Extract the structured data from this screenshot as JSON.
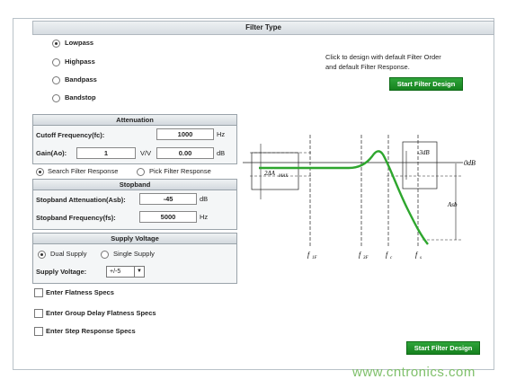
{
  "filter_type": {
    "title": "Filter Type",
    "options": [
      "Lowpass",
      "Highpass",
      "Bandpass",
      "Bandstop"
    ],
    "selected": "Lowpass",
    "hint_line1": "Click to design with default Filter Order",
    "hint_line2": "and default Filter Response.",
    "button": "Start Filter Design"
  },
  "attenuation": {
    "title": "Attenuation",
    "cutoff_label": "Cutoff Frequency(fc):",
    "cutoff_value": "1000",
    "cutoff_unit": "Hz",
    "gain_label": "Gain(Ao):",
    "gain_value": "1",
    "gain_unit": "V/V",
    "gain_db_value": "0.00",
    "gain_db_unit": "dB"
  },
  "search_mode": {
    "search_label": "Search Filter Response",
    "pick_label": "Pick Filter Response",
    "selected": "search"
  },
  "stopband": {
    "title": "Stopband",
    "attenuation_label": "Stopband Attenuation(Asb):",
    "attenuation_value": "-45",
    "attenuation_unit": "dB",
    "frequency_label": "Stopband Frequency(fs):",
    "frequency_value": "5000",
    "frequency_unit": "Hz"
  },
  "supply": {
    "title": "Supply Voltage",
    "dual_label": "Dual Supply",
    "single_label": "Single Supply",
    "selected": "dual",
    "voltage_label": "Supply Voltage:",
    "voltage_value": "+/-5"
  },
  "checkboxes": [
    "Enter Flatness Specs",
    "Enter Group Delay Flatness Specs",
    "Enter Step Response Specs"
  ],
  "bottom_button": "Start Filter Design",
  "diagram": {
    "label_0db": "0dB",
    "label_3db": "-3dB",
    "label_delta": "2ΔA",
    "label_delta_sub": "MAX",
    "label_asb": "Asb",
    "label_f1f": "f",
    "label_f1f_sub": "1F",
    "label_f3f": "f",
    "label_f3f_sub": "3F",
    "label_fc": "f",
    "label_fc_sub": "c",
    "label_fs": "f",
    "label_fs_sub": "s",
    "curve_color": "#2ea62e"
  },
  "watermark": "www.cntronics.com"
}
